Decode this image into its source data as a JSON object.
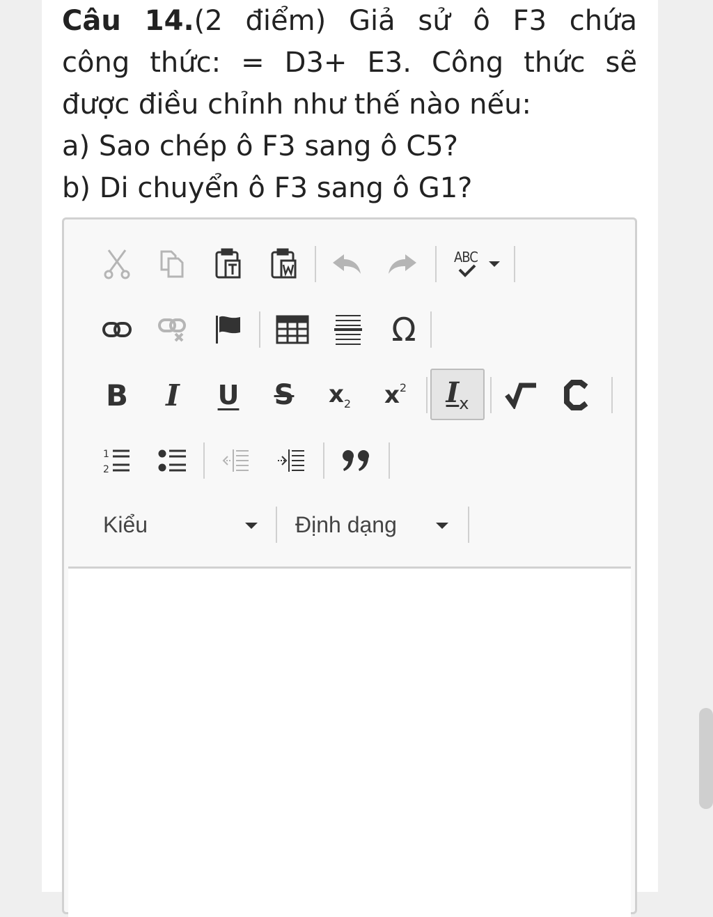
{
  "question": {
    "number": "Câu 14.",
    "line1_rest": "(2 điểm) Giả sử ô F3 chứa",
    "line2": "công thức: = D3+ E3. Công thức sẽ",
    "line3": "được điều chỉnh như thế nào nếu:",
    "line4": "a) Sao chép ô F3 sang ô C5?",
    "line5": "b) Di chuyển ô F3 sang ô G1?"
  },
  "toolbar": {
    "row1": [
      "cut-icon",
      "copy-icon",
      "paste-text-icon",
      "paste-word-icon",
      "undo-icon",
      "redo-icon",
      "spellcheck-icon"
    ],
    "spellcheck_label": "ABC",
    "row2": [
      "link-icon",
      "unlink-icon",
      "anchor-flag-icon",
      "table-icon",
      "horizontal-line-icon",
      "special-char-icon"
    ],
    "special_char": "Ω",
    "row3": {
      "bold": "B",
      "italic": "I",
      "underline": "U",
      "strike": "S",
      "subscript": "x",
      "subscript_small": "2",
      "superscript": "x",
      "superscript_small": "2",
      "remove_format": "I",
      "remove_format_x": "x"
    },
    "row4": [
      "numbered-list-icon",
      "bulleted-list-icon",
      "outdent-icon",
      "indent-icon",
      "blockquote-icon"
    ],
    "style_combo": "Kiểu",
    "format_combo": "Định dạng"
  },
  "colors": {
    "text": "#222222",
    "icon": "#333333",
    "icon_disabled": "#b5b5b5",
    "toolbar_bg": "#f8f8f8",
    "border": "#d1d1d1"
  }
}
